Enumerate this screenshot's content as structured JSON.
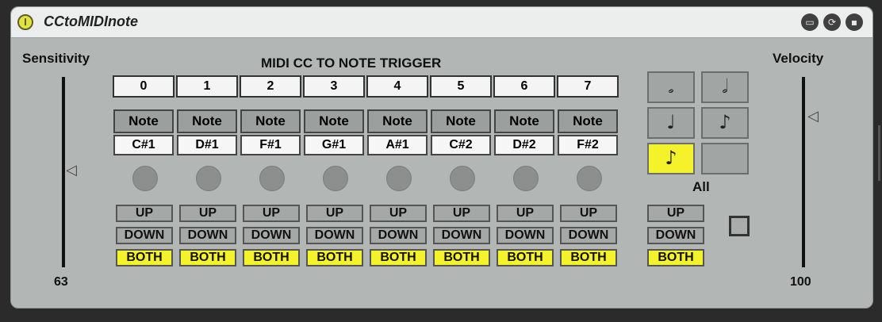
{
  "device": {
    "title": "CCtoMIDInote"
  },
  "titlebar_icons": [
    "fold-icon",
    "hotswap-icon",
    "save-icon"
  ],
  "header": "MIDI CC TO NOTE TRIGGER",
  "sensitivity": {
    "label": "Sensitivity",
    "value": "63"
  },
  "velocity": {
    "label": "Velocity",
    "value": "100"
  },
  "channels": [
    {
      "num": "0",
      "hdr": "Note",
      "note": "C#1",
      "mode": "BOTH"
    },
    {
      "num": "1",
      "hdr": "Note",
      "note": "D#1",
      "mode": "BOTH"
    },
    {
      "num": "2",
      "hdr": "Note",
      "note": "F#1",
      "mode": "BOTH"
    },
    {
      "num": "3",
      "hdr": "Note",
      "note": "G#1",
      "mode": "BOTH"
    },
    {
      "num": "4",
      "hdr": "Note",
      "note": "A#1",
      "mode": "BOTH"
    },
    {
      "num": "5",
      "hdr": "Note",
      "note": "C#2",
      "mode": "BOTH"
    },
    {
      "num": "6",
      "hdr": "Note",
      "note": "D#2",
      "mode": "BOTH"
    },
    {
      "num": "7",
      "hdr": "Note",
      "note": "F#2",
      "mode": "BOTH"
    }
  ],
  "trigger_labels": {
    "up": "UP",
    "down": "DOWN",
    "both": "BOTH"
  },
  "note_length_buttons": [
    {
      "name": "half-note-hollow-icon",
      "glyph": "𝅗",
      "selected": false
    },
    {
      "name": "half-note-icon",
      "glyph": "𝅗𝅥",
      "selected": false
    },
    {
      "name": "quarter-note-icon",
      "glyph": "♩",
      "selected": false
    },
    {
      "name": "eighth-note-icon",
      "glyph": "♪",
      "selected": false
    },
    {
      "name": "sixteenth-note-icon",
      "glyph": "♪",
      "selected": true
    },
    {
      "name": "empty-note-button",
      "glyph": "",
      "selected": false
    }
  ],
  "all": {
    "label": "All",
    "mode": "BOTH"
  },
  "colors": {
    "accent": "#f4f22b",
    "panel": "#b2b6b4"
  }
}
